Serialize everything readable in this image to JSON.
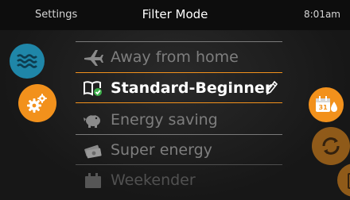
{
  "header": {
    "settings_label": "Settings",
    "title": "Filter Mode",
    "time": "8:01am"
  },
  "colors": {
    "accent": "#f2911c",
    "blue": "#1f86a8",
    "text_dim": "#7e7e7e",
    "text_selected": "#ffffff"
  },
  "left_buttons": [
    {
      "icon": "waves-icon"
    },
    {
      "icon": "gears-icon"
    }
  ],
  "right_buttons": [
    {
      "icon": "calendar-drop-icon"
    },
    {
      "icon": "cycle-icon"
    },
    {
      "icon": "clipboard-icon"
    }
  ],
  "modes": [
    {
      "label": "Away from home",
      "icon": "airplane-icon",
      "selected": false
    },
    {
      "label": "Standard-Beginner",
      "icon": "book-check-icon",
      "selected": true
    },
    {
      "label": "Energy saving",
      "icon": "piggy-bank-icon",
      "selected": false
    },
    {
      "label": "Super energy",
      "icon": "money-icon",
      "selected": false
    },
    {
      "label": "Weekender",
      "icon": "calendar-icon",
      "selected": false
    }
  ]
}
